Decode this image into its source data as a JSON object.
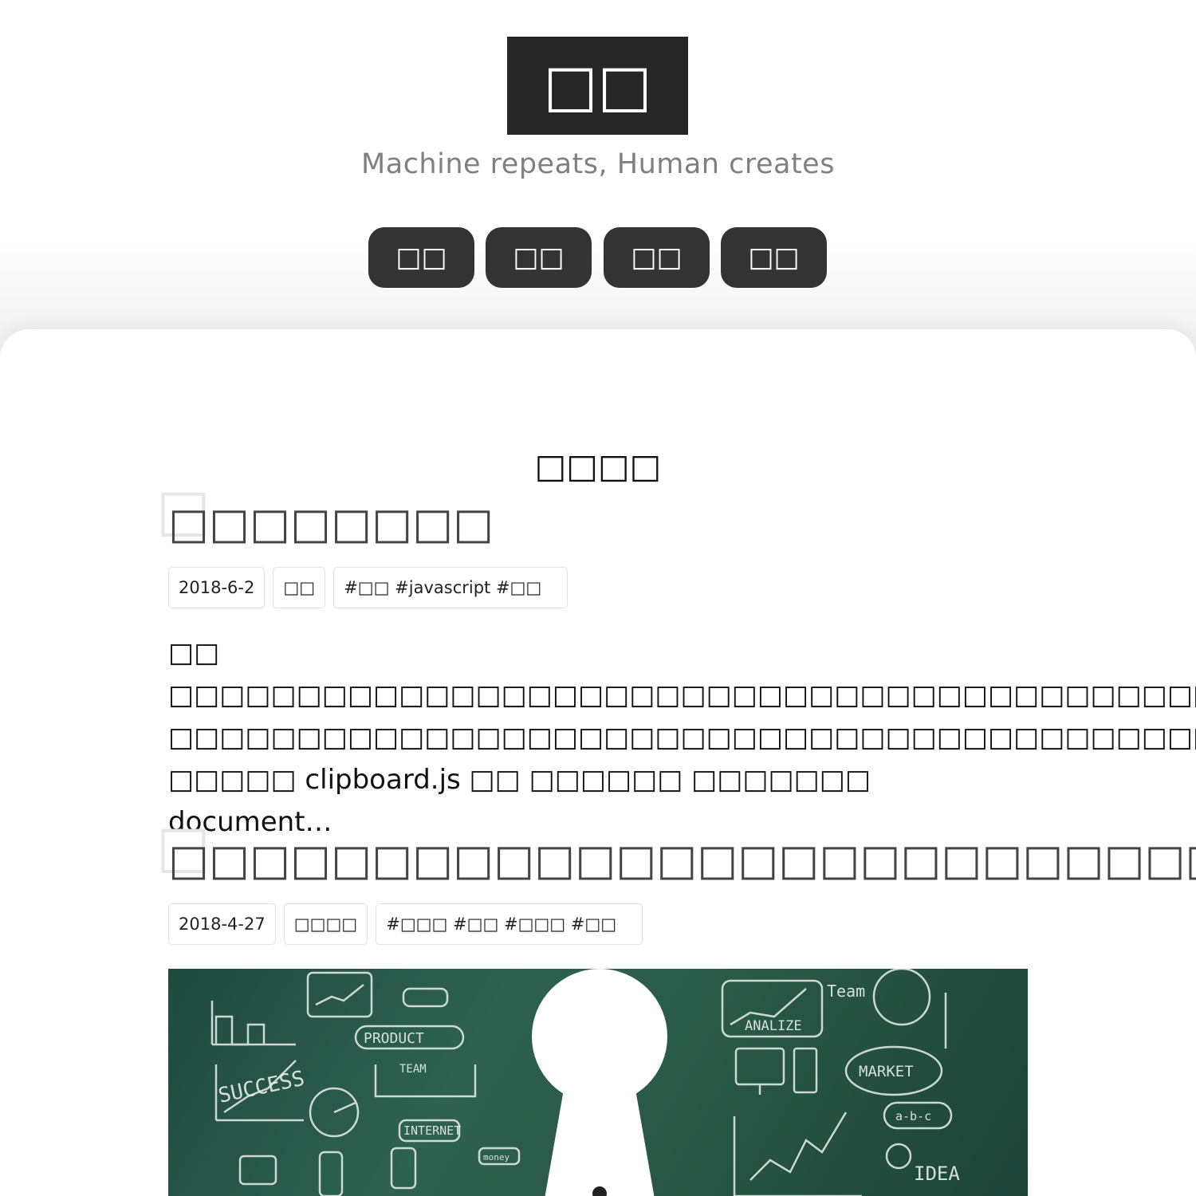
{
  "header": {
    "logo_text": "□□",
    "slogan": "Machine repeats, Human creates"
  },
  "nav": {
    "items": [
      {
        "label": "□□"
      },
      {
        "label": "□□"
      },
      {
        "label": "□□"
      },
      {
        "label": "□□"
      }
    ]
  },
  "main": {
    "section_title": "□□□□",
    "posts": [
      {
        "ghost_glyph": "□",
        "title": "□□□□□□□□",
        "date": "2018-6-2",
        "category": "□□",
        "tags": "#□□ #javascript #□□",
        "excerpt": "□□ □□□□□□□□□□□□□□□□□□□□□□□□□□□□□□□□□□□□□□□□□□□□□□□□□□□□□□□□□□□□□□ □□□□□□□□□□□□□□□□□□□□□□□□□□□□□□□□□□□□□□□□□□□□□□□ □□□□□ clipboard.js □□ □□□□□□ □□□□□□□ document…"
      },
      {
        "ghost_glyph": "□",
        "title": "□□□□□□□□□□□□□□□□□□□□□□□□□□□□□",
        "date": "2018-4-27",
        "category": "□□□□",
        "tags": "#□□□ #□□ #□□□ #□□",
        "image_words": [
          "PRODUCT",
          "SUCCESS",
          "TEAM",
          "INTERNET",
          "ANALIZE",
          "MARKET",
          "IDEA",
          "Team",
          "a-b-c",
          "money"
        ]
      }
    ]
  },
  "colors": {
    "logo_bg": "#262626",
    "nav_bg": "#333333",
    "chalkboard": "#2e6150",
    "chalk": "#e8f0ec"
  }
}
